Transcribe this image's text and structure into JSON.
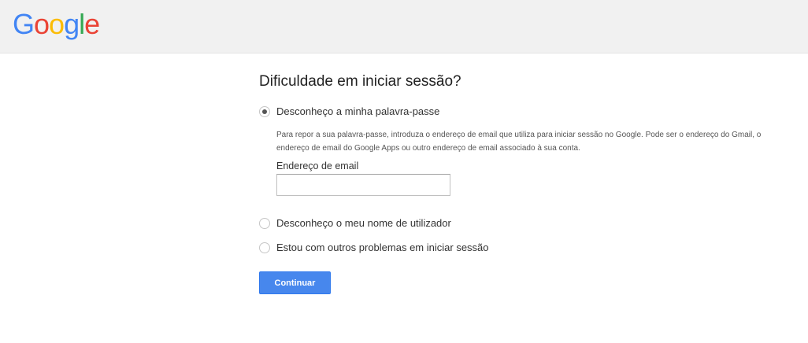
{
  "header": {
    "logo_letters": [
      {
        "char": "G",
        "color": "#4285F4"
      },
      {
        "char": "o",
        "color": "#EA4335"
      },
      {
        "char": "o",
        "color": "#FBBC05"
      },
      {
        "char": "g",
        "color": "#4285F4"
      },
      {
        "char": "l",
        "color": "#34A853"
      },
      {
        "char": "e",
        "color": "#EA4335"
      }
    ]
  },
  "main": {
    "title": "Dificuldade em iniciar sessão?",
    "options": [
      {
        "label": "Desconheço a minha palavra-passe",
        "checked": true
      },
      {
        "label": "Desconheço o meu nome de utilizador",
        "checked": false
      },
      {
        "label": "Estou com outros problemas em iniciar sessão",
        "checked": false
      }
    ],
    "help_text": "Para repor a sua palavra-passe, introduza o endereço de email que utiliza para iniciar sessão no Google. Pode ser o endereço do Gmail, o endereço de email do Google Apps ou outro endereço de email associado à sua conta.",
    "email_label": "Endereço de email",
    "email_value": "",
    "continue_label": "Continuar"
  }
}
